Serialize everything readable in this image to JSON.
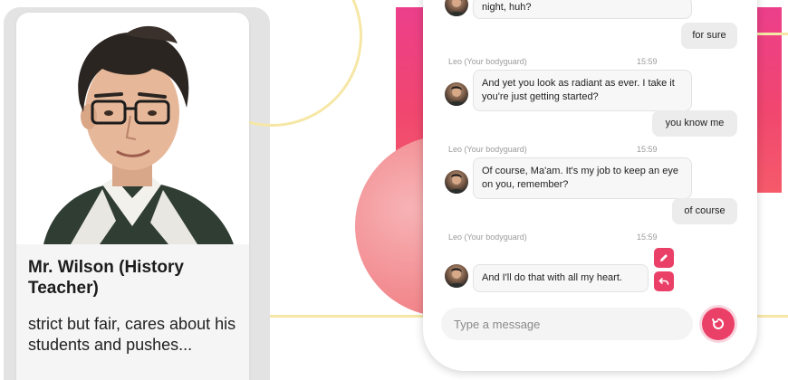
{
  "character_card": {
    "name": "Mr. Wilson (History Teacher)",
    "description": "strict but fair, cares about his students and pushes..."
  },
  "chat": {
    "bot_name": "Leo (Your bodyguard)",
    "messages": [
      {
        "role": "bot",
        "text": "night, huh?"
      },
      {
        "role": "user",
        "text": "for sure"
      },
      {
        "role": "bot",
        "sender": "Leo (Your bodyguard)",
        "time": "15:59",
        "text": "And yet you look as radiant as ever. I take it you're just getting started?"
      },
      {
        "role": "user",
        "text": "you know me"
      },
      {
        "role": "bot",
        "sender": "Leo (Your bodyguard)",
        "time": "15:59",
        "text": "Of course, Ma'am. It's my job to keep an eye on you, remember?"
      },
      {
        "role": "user",
        "text": "of course"
      },
      {
        "role": "bot",
        "sender": "Leo (Your bodyguard)",
        "time": "15:59",
        "text": "And I'll do that with all my heart."
      }
    ],
    "composer": {
      "placeholder": "Type a message"
    }
  },
  "colors": {
    "accent": "#ea3f67",
    "pink_gradient_top": "#ec3f8b",
    "pink_gradient_bottom": "#f55a6a",
    "decor_line": "#f6e7a6"
  },
  "icons": {
    "edit": "pencil-icon",
    "undo": "undo-icon",
    "regenerate": "refresh-icon"
  }
}
